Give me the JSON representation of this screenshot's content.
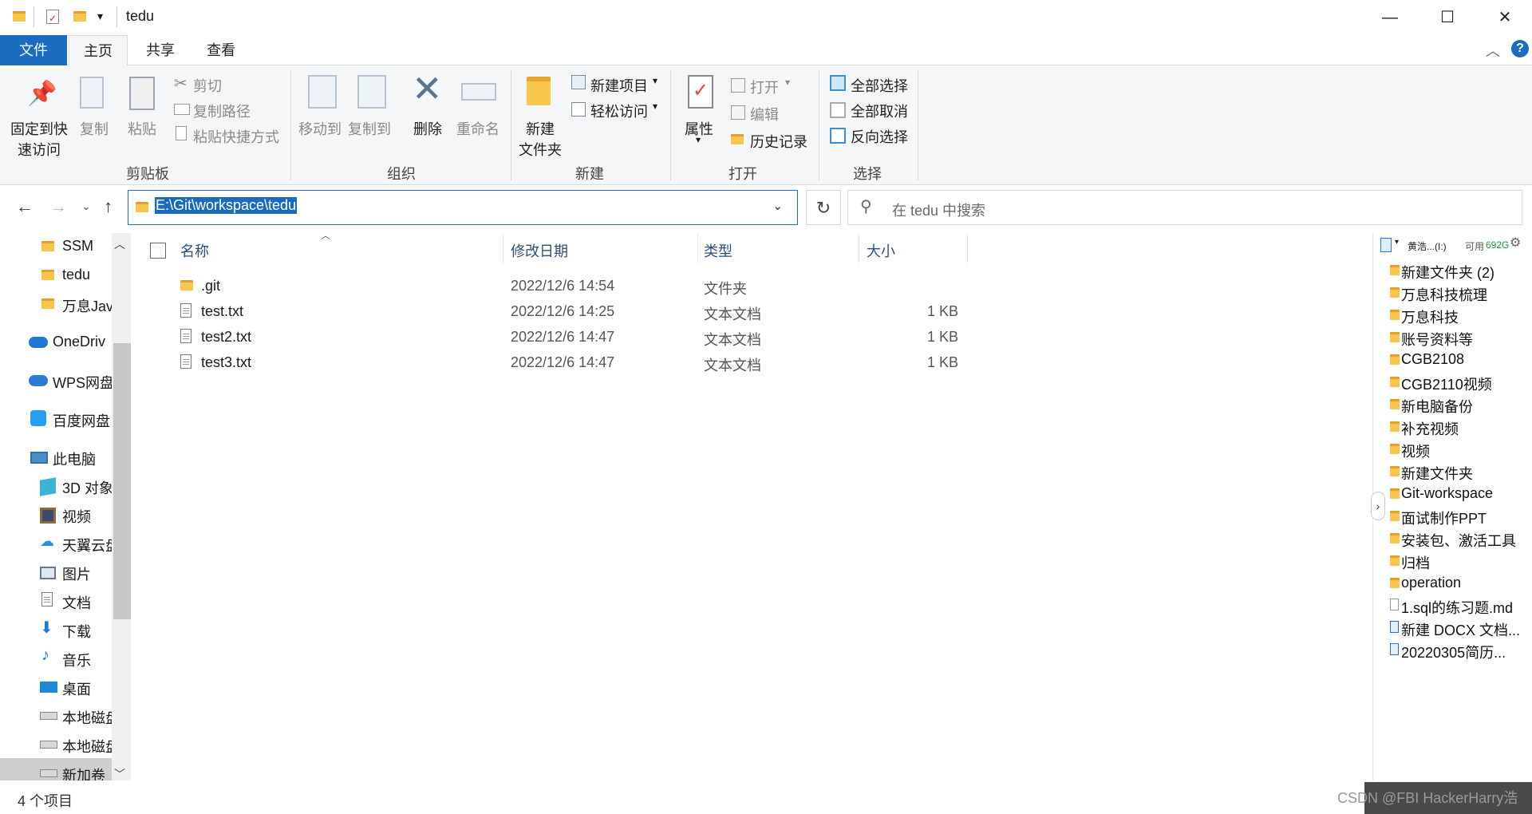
{
  "window": {
    "title": "tedu"
  },
  "ribbon_tabs": {
    "file": "文件",
    "home": "主页",
    "share": "共享",
    "view": "查看"
  },
  "ribbon": {
    "clipboard": {
      "pin": "固定到快\n速访问",
      "pin_l1": "固定到快",
      "pin_l2": "速访问",
      "copy": "复制",
      "paste": "粘贴",
      "cut": "剪切",
      "copy_path": "复制路径",
      "paste_shortcut": "粘贴快捷方式",
      "group": "剪贴板"
    },
    "organize": {
      "move_to": "移动到",
      "copy_to": "复制到",
      "delete": "删除",
      "rename": "重命名",
      "group": "组织"
    },
    "new": {
      "new_folder_l1": "新建",
      "new_folder_l2": "文件夹",
      "new_item": "新建项目",
      "easy_access": "轻松访问",
      "group": "新建"
    },
    "open": {
      "properties": "属性",
      "open": "打开",
      "edit": "编辑",
      "history": "历史记录",
      "group": "打开"
    },
    "select": {
      "select_all": "全部选择",
      "select_none": "全部取消",
      "invert": "反向选择",
      "group": "选择"
    }
  },
  "address": {
    "path": "E:\\Git\\workspace\\tedu",
    "search_placeholder": "在 tedu 中搜索"
  },
  "nav": {
    "items": [
      "SSM",
      "tedu",
      "万息Jav",
      "OneDriv",
      "WPS网盘",
      "百度网盘",
      "此电脑",
      "3D 对象",
      "视频",
      "天翼云盘",
      "图片",
      "文档",
      "下载",
      "音乐",
      "桌面",
      "本地磁盘",
      "本地磁盘",
      "新加卷"
    ]
  },
  "columns": {
    "name": "名称",
    "date": "修改日期",
    "type": "类型",
    "size": "大小"
  },
  "files": [
    {
      "name": ".git",
      "date": "2022/12/6 14:54",
      "type": "文件夹",
      "size": ""
    },
    {
      "name": "test.txt",
      "date": "2022/12/6 14:25",
      "type": "文本文档",
      "size": "1 KB"
    },
    {
      "name": "test2.txt",
      "date": "2022/12/6 14:47",
      "type": "文本文档",
      "size": "1 KB"
    },
    {
      "name": "test3.txt",
      "date": "2022/12/6 14:47",
      "type": "文本文档",
      "size": "1 KB"
    }
  ],
  "right_pane": {
    "drive_label": "黄浩...(I:)",
    "free_label": "可用",
    "free_value": "692G",
    "items": [
      "新建文件夹 (2)",
      "万息科技梳理",
      "万息科技",
      "账号资料等",
      "CGB2108",
      "CGB2110视频",
      "新电脑备份",
      "补充视频",
      "视频",
      "新建文件夹",
      "Git-workspace",
      "面试制作PPT",
      "安装包、激活工具",
      "归档",
      "operation",
      "1.sql的练习题.md",
      "新建 DOCX 文档...",
      "20220305简历..."
    ]
  },
  "status": {
    "count": "4 个项目"
  },
  "watermark": "CSDN @FBI HackerHarry浩"
}
